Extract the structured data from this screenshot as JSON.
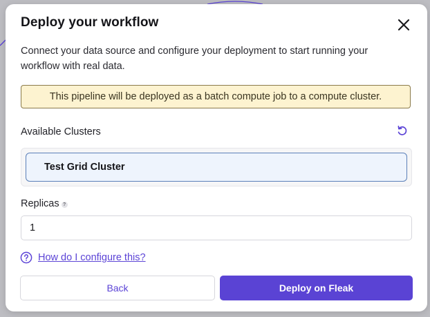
{
  "modal": {
    "title": "Deploy your workflow",
    "description": "Connect your data source and configure your deployment to start running your workflow with real data.",
    "banner": "This pipeline will be deployed as a batch compute job to a compute cluster."
  },
  "clusters": {
    "label": "Available Clusters",
    "items": [
      {
        "name": "Test Grid Cluster",
        "selected": true
      }
    ]
  },
  "replicas": {
    "label": "Replicas",
    "help_glyph": "?",
    "value": "1"
  },
  "help": {
    "link_text": "How do I configure this?"
  },
  "actions": {
    "back_label": "Back",
    "deploy_label": "Deploy on Fleak"
  },
  "icons": {
    "close": "close-icon",
    "refresh": "refresh-icon",
    "help": "question-circle-icon"
  },
  "colors": {
    "accent": "#5a43d4",
    "banner_bg": "#fdf3d0",
    "selected_bg": "#eef4fd",
    "selected_border": "#5a7fb8"
  }
}
